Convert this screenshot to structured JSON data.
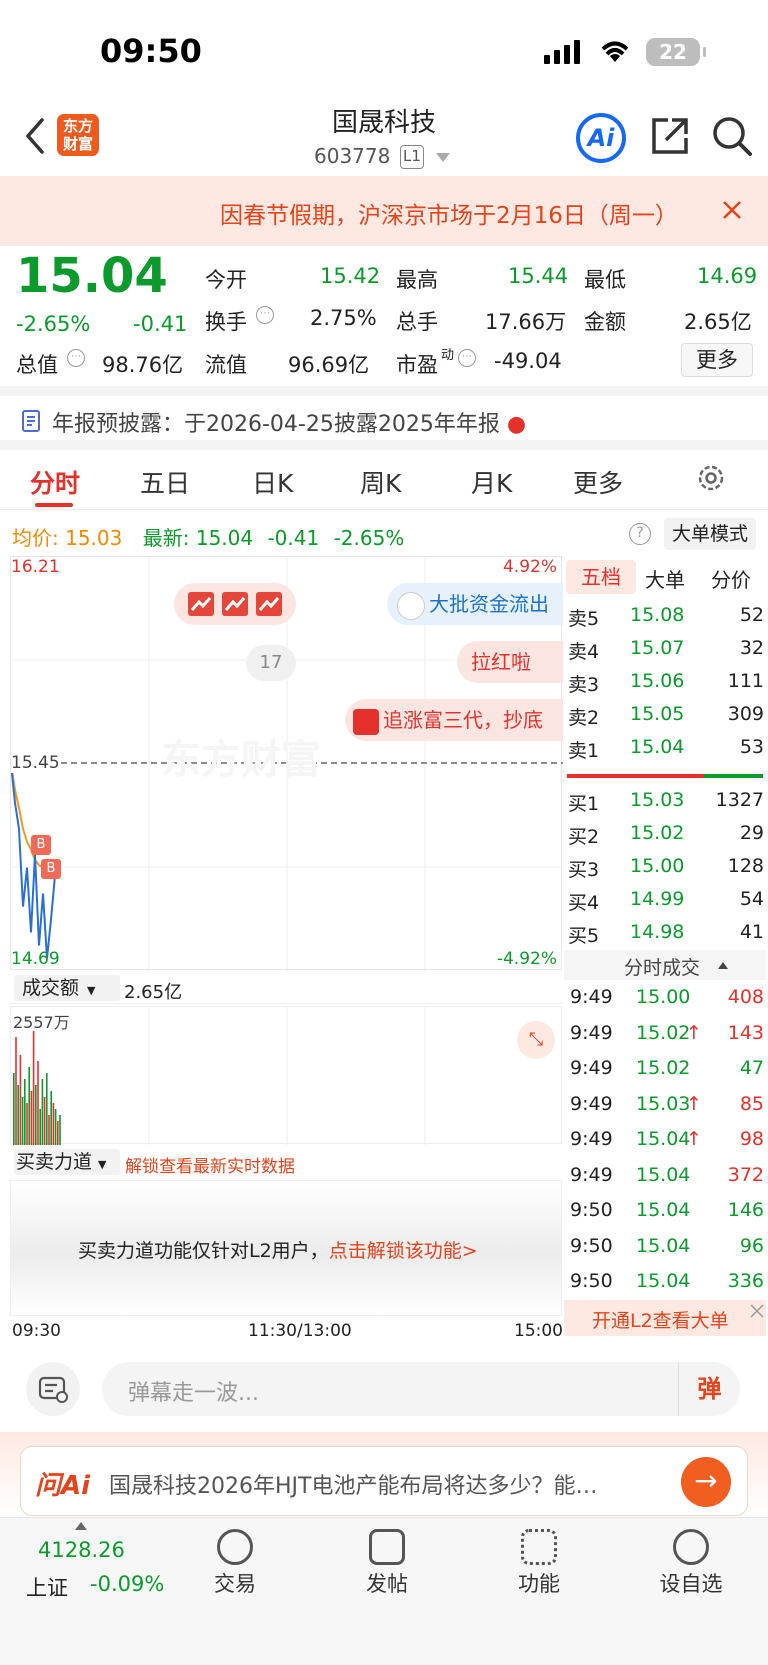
{
  "status": {
    "time": "09:50",
    "battery": "22"
  },
  "header": {
    "title": "国晟科技",
    "code": "603778",
    "level": "L1",
    "logo": "东方财富",
    "ai_label": "Ai"
  },
  "notice": {
    "text": "因春节假期，沪深京市场于2月16日（周一）"
  },
  "quote": {
    "price": "15.04",
    "pct": "-2.65%",
    "chg": "-0.41",
    "fields": [
      {
        "label": "今开",
        "value": "15.42"
      },
      {
        "label": "最高",
        "value": "15.44"
      },
      {
        "label": "最低",
        "value": "14.69"
      },
      {
        "label": "换手",
        "value": "2.75%"
      },
      {
        "label": "总手",
        "value": "17.66万"
      },
      {
        "label": "金额",
        "value": "2.65亿"
      },
      {
        "label": "总值",
        "value": "98.76亿"
      },
      {
        "label": "流值",
        "value": "96.69亿"
      },
      {
        "label": "市盈",
        "sup": "动",
        "value": "-49.04"
      }
    ],
    "more": "更多"
  },
  "report": {
    "text": "年报预披露：于2026-04-25披露2025年年报"
  },
  "tabs": [
    "分时",
    "五日",
    "日K",
    "周K",
    "月K",
    "更多"
  ],
  "info": {
    "avg_label": "均价:",
    "avg": "15.03",
    "latest_label": "最新:",
    "latest": "15.04",
    "chg": "-0.41",
    "pct": "-2.65%",
    "bigmode": "大单模式"
  },
  "chart": {
    "top_price": "16.21",
    "top_pct": "4.92%",
    "mid_price": "15.45",
    "low_price": "14.69",
    "low_pct": "-4.92%",
    "badge17": "17",
    "bubble1": "大批资金流出",
    "bubble2": "拉红啦",
    "bubble3": "追涨富三代，抄底",
    "watermark": "东方财富",
    "b_marker": "B",
    "price_line": [
      15.45,
      15.3,
      15.2,
      14.9,
      15.05,
      14.8,
      15.1,
      14.75,
      14.95,
      14.7,
      14.85,
      15.02
    ],
    "avg_line": [
      15.45,
      15.35,
      15.28,
      15.2,
      15.15,
      15.12,
      15.08,
      15.06,
      15.05,
      15.04,
      15.03,
      15.03
    ]
  },
  "volume": {
    "selector": "成交额",
    "total": "2.65亿",
    "max_label": "2557万",
    "bars": [
      0.6,
      0.9,
      0.5,
      0.75,
      0.4,
      0.55,
      0.35,
      0.65,
      0.45,
      0.95,
      0.5,
      0.7,
      0.3,
      0.55,
      0.4,
      0.6,
      0.25,
      0.45,
      0.35,
      0.3,
      0.2,
      0.25
    ],
    "colors": [
      "g",
      "r",
      "g",
      "r",
      "g",
      "g",
      "r",
      "g",
      "r",
      "r",
      "g",
      "r",
      "g",
      "g",
      "r",
      "g",
      "r",
      "g",
      "r",
      "g",
      "r",
      "g"
    ]
  },
  "force": {
    "selector": "买卖力道",
    "unlock": "解锁查看最新实时数据",
    "msg": "买卖力道功能仅针对L2用户，",
    "link": "点击解锁该功能>"
  },
  "xaxis": {
    "start": "09:30",
    "mid": "11:30/13:00",
    "end": "15:00"
  },
  "orderbook": {
    "tabs": [
      "五档",
      "大单",
      "分价"
    ],
    "asks": [
      {
        "label": "卖5",
        "price": "15.08",
        "vol": "52"
      },
      {
        "label": "卖4",
        "price": "15.07",
        "vol": "32"
      },
      {
        "label": "卖3",
        "price": "15.06",
        "vol": "111"
      },
      {
        "label": "卖2",
        "price": "15.05",
        "vol": "309"
      },
      {
        "label": "卖1",
        "price": "15.04",
        "vol": "53"
      }
    ],
    "bids": [
      {
        "label": "买1",
        "price": "15.03",
        "vol": "1327"
      },
      {
        "label": "买2",
        "price": "15.02",
        "vol": "29"
      },
      {
        "label": "买3",
        "price": "15.00",
        "vol": "128"
      },
      {
        "label": "买4",
        "price": "14.99",
        "vol": "54"
      },
      {
        "label": "买5",
        "price": "14.98",
        "vol": "41"
      }
    ],
    "trades_title": "分时成交",
    "trades": [
      {
        "t": "9:49",
        "p": "15.00",
        "v": "408",
        "c": "red",
        "up": ""
      },
      {
        "t": "9:49",
        "p": "15.02",
        "v": "143",
        "c": "red",
        "up": "↑"
      },
      {
        "t": "9:49",
        "p": "15.02",
        "v": "47",
        "c": "green",
        "up": ""
      },
      {
        "t": "9:49",
        "p": "15.03",
        "v": "85",
        "c": "red",
        "up": "↑"
      },
      {
        "t": "9:49",
        "p": "15.04",
        "v": "98",
        "c": "red",
        "up": "↑"
      },
      {
        "t": "9:49",
        "p": "15.04",
        "v": "372",
        "c": "red",
        "up": ""
      },
      {
        "t": "9:50",
        "p": "15.04",
        "v": "146",
        "c": "green",
        "up": ""
      },
      {
        "t": "9:50",
        "p": "15.04",
        "v": "96",
        "c": "green",
        "up": ""
      },
      {
        "t": "9:50",
        "p": "15.04",
        "v": "336",
        "c": "green",
        "up": ""
      }
    ],
    "l2_banner": "开通L2查看大单"
  },
  "danmu": {
    "placeholder": "弹幕走一波...",
    "send": "弹"
  },
  "ask_ai": {
    "brand": "问Ai",
    "question": "国晟科技2026年HJT电池产能布局将达多少？能…"
  },
  "bottom_nav": {
    "index_value": "4128.26",
    "index_name": "上证",
    "index_pct": "-0.09%",
    "trade": "交易",
    "post": "发帖",
    "func": "功能",
    "watch": "设自选"
  },
  "colors": {
    "red": "#e5312c",
    "green": "#0b9a2c",
    "orange": "#f28a00",
    "blue": "#1668f6"
  }
}
